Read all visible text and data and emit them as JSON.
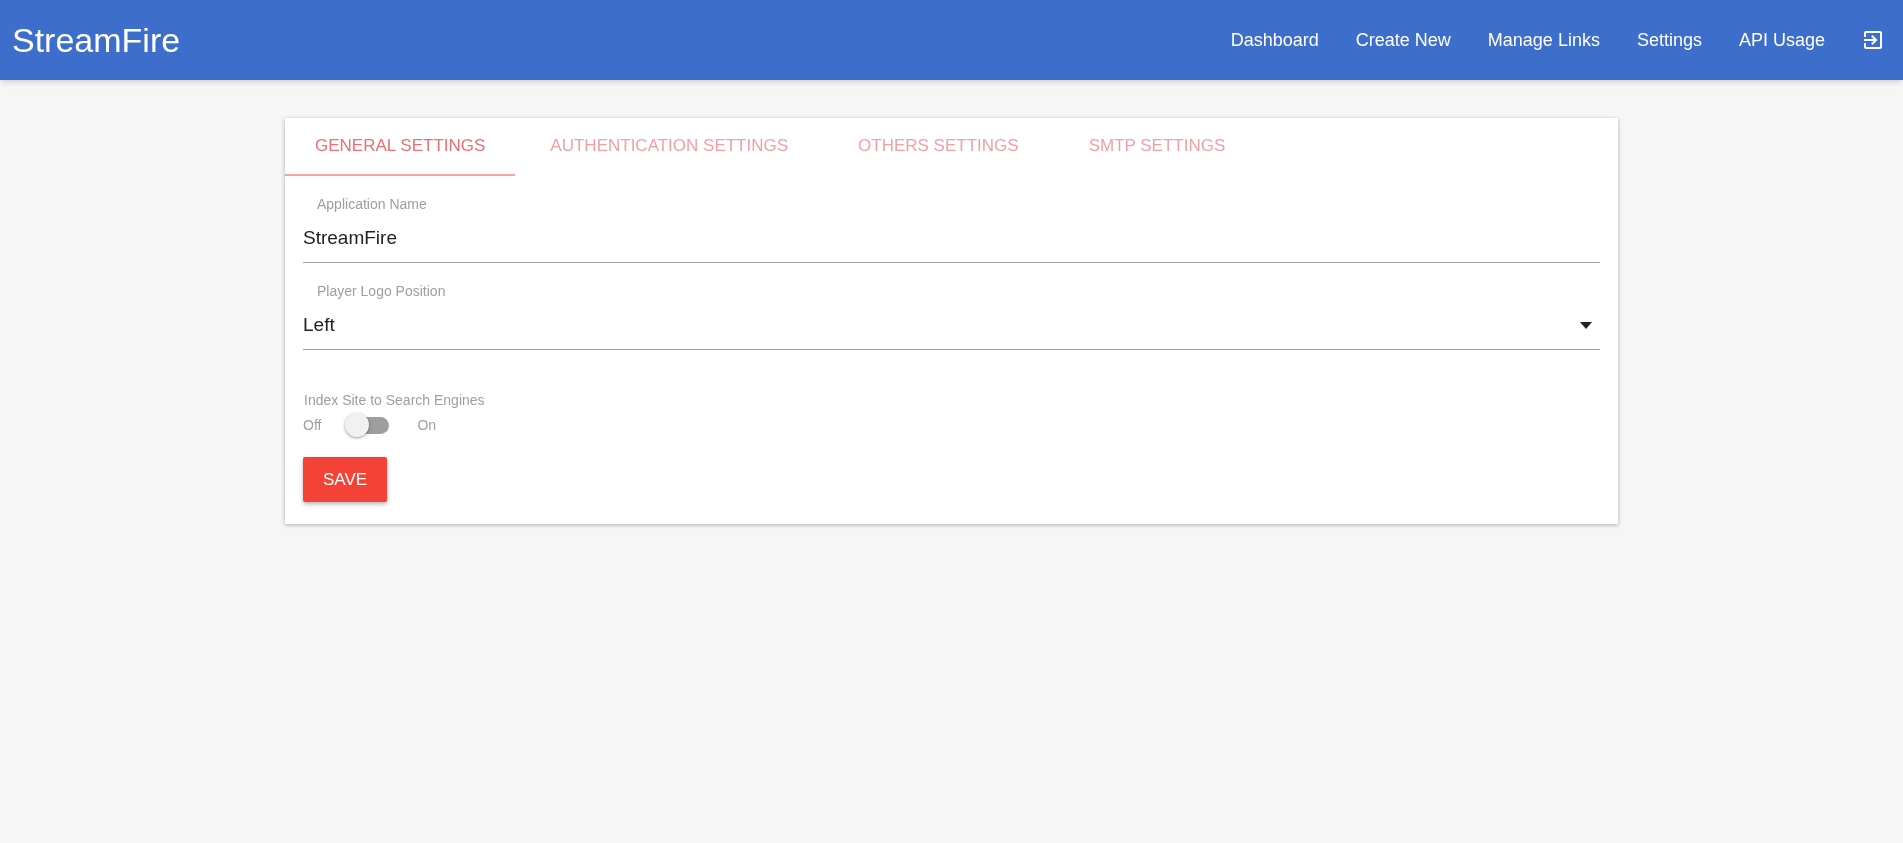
{
  "navbar": {
    "brand": "StreamFire",
    "links": [
      {
        "label": "Dashboard"
      },
      {
        "label": "Create New"
      },
      {
        "label": "Manage Links"
      },
      {
        "label": "Settings"
      },
      {
        "label": "API Usage"
      }
    ]
  },
  "tabs": [
    {
      "label": "GENERAL SETTINGS",
      "selected": true
    },
    {
      "label": "AUTHENTICATION SETTINGS",
      "selected": false
    },
    {
      "label": "OTHERS SETTINGS",
      "selected": false
    },
    {
      "label": "SMTP SETTINGS",
      "selected": false
    }
  ],
  "fields": [
    {
      "kind": "text",
      "label": "Application Name",
      "value": "StreamFire"
    },
    {
      "kind": "select",
      "label": "Player Logo Position",
      "value": "Left"
    }
  ],
  "toggle": {
    "label": "Index Site to Search Engines",
    "off_label": "Off",
    "on_label": "On",
    "on": false
  },
  "save_button": "SAVE"
}
